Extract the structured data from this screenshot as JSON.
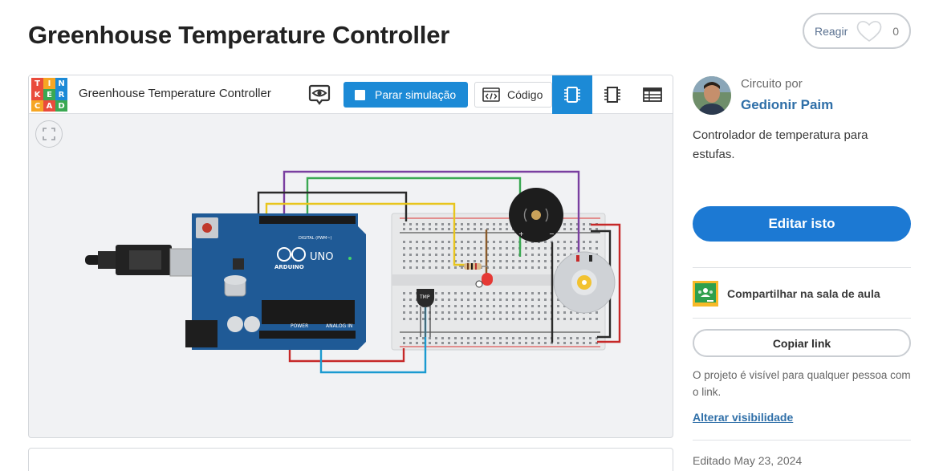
{
  "page": {
    "title": "Greenhouse Temperature Controller"
  },
  "react": {
    "label": "Reagir",
    "count": "0",
    "icon": "heart-icon"
  },
  "viewer": {
    "logo_letters": [
      "T",
      "I",
      "N",
      "K",
      "E",
      "R",
      "C",
      "A",
      "D"
    ],
    "logo_colors": [
      "#e94b3c",
      "#f6a624",
      "#1c8ad6",
      "#e94b3c",
      "#3aa852",
      "#1c8ad6",
      "#f6a624",
      "#e94b3c",
      "#3aa852"
    ],
    "title": "Greenhouse Temperature Controller",
    "simulate_label": "Parar simulação",
    "code_label": "Código",
    "accent": "#1c8ad6",
    "board": {
      "brand": "ARDUINO",
      "model": "UNO",
      "digital_label": "DIGITAL (PWM~)",
      "power_label": "POWER",
      "analog_label": "ANALOG IN",
      "sensor_label": "TMP"
    }
  },
  "sidebar": {
    "circuit_by": "Circuito por",
    "author": "Gedionir Paim",
    "description": "Controlador de temperatura para estufas.",
    "edit_label": "Editar isto",
    "share_label": "Compartilhar na sala de aula",
    "copy_label": "Copiar link",
    "visibility_note": "O projeto é visível para qualquer pessoa com o link.",
    "change_visibility": "Alterar visibilidade",
    "edited": "Editado May 23, 2024"
  }
}
